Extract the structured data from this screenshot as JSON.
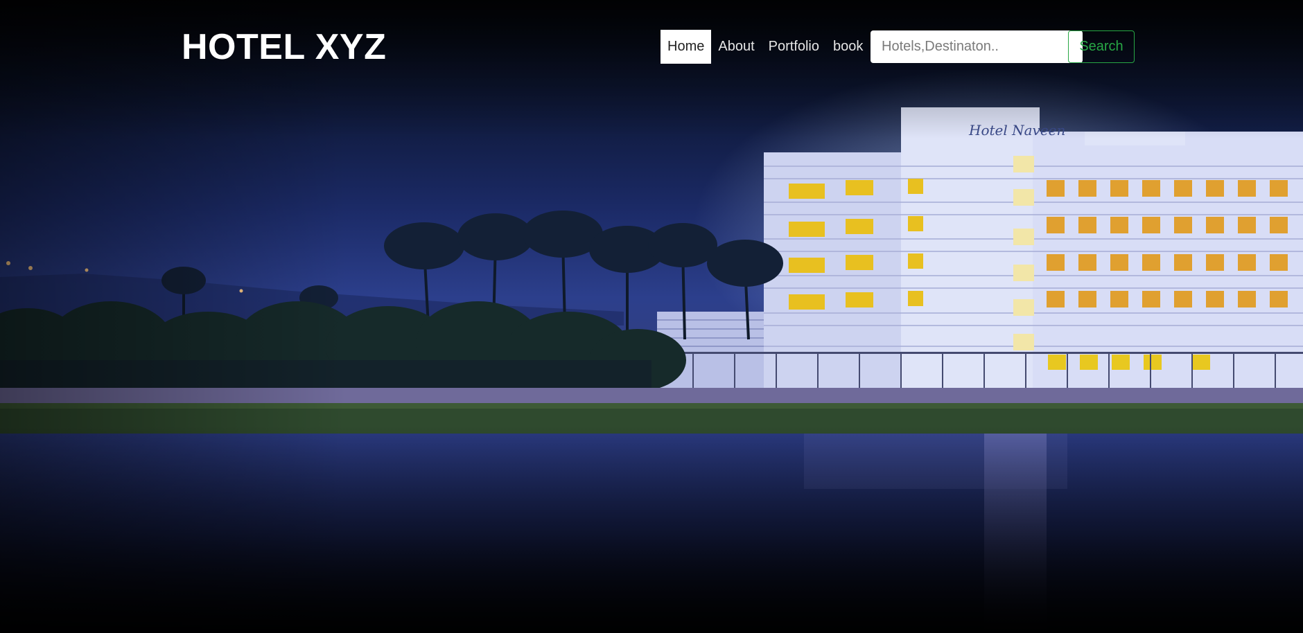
{
  "brand": {
    "title": "HOTEL XYZ"
  },
  "nav": {
    "items": [
      {
        "label": "Home",
        "active": true
      },
      {
        "label": "About",
        "active": false
      },
      {
        "label": "Portfolio",
        "active": false
      },
      {
        "label": "book",
        "active": false
      }
    ]
  },
  "search": {
    "placeholder": "Hotels,Destinaton..",
    "value": "",
    "button_label": "Search"
  },
  "hero": {
    "sign_text": "Hotel Naveen"
  },
  "colors": {
    "accent_green": "#28a745",
    "nav_active_bg": "#ffffff",
    "brand_text": "#ffffff"
  }
}
